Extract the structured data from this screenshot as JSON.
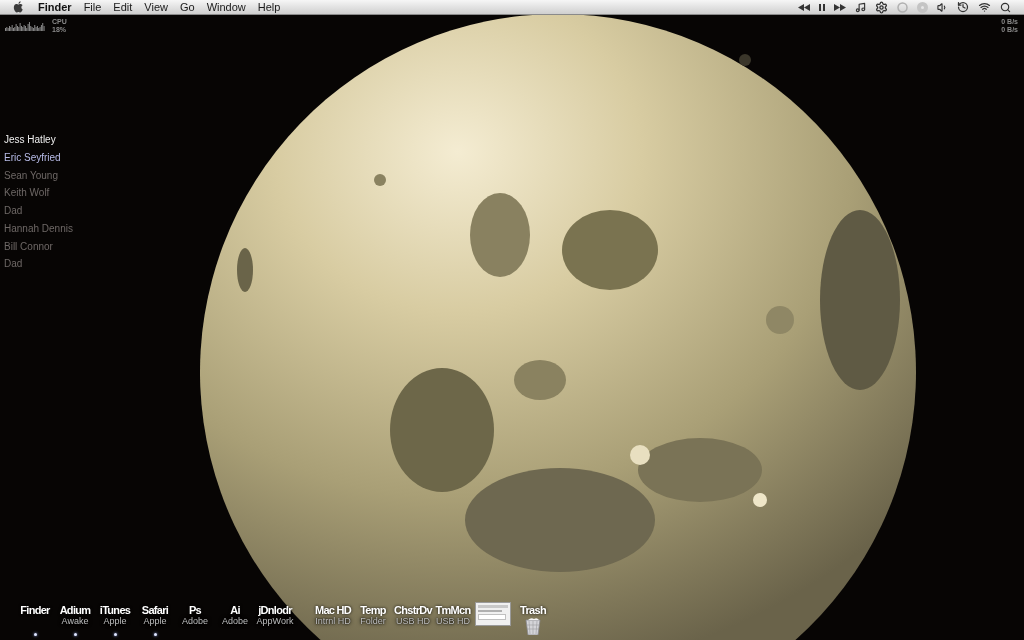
{
  "menu_bar": {
    "app_name": "Finder",
    "menus": [
      "File",
      "Edit",
      "View",
      "Go",
      "Window",
      "Help"
    ]
  },
  "cpu_monitor": {
    "label": "CPU",
    "reading": "18%"
  },
  "network_monitor": {
    "readings": [
      "0 B/s",
      "0 B/s"
    ]
  },
  "contacts": [
    {
      "name": "Jess Hatley",
      "color": "#f0f0f0"
    },
    {
      "name": "Eric Seyfried",
      "color": "#b8bce8"
    },
    {
      "name": "Sean Young",
      "color": "#6e6866"
    },
    {
      "name": "Keith Wolf",
      "color": "#6e6866"
    },
    {
      "name": "Dad",
      "color": "#6e6866"
    },
    {
      "name": "Hannah Dennis",
      "color": "#6e6866"
    },
    {
      "name": "Bill Connor",
      "color": "#6e6866"
    },
    {
      "name": "Dad",
      "color": "#6e6866"
    }
  ],
  "dock": {
    "apps": [
      {
        "label": "Finder",
        "running": true
      },
      {
        "label": "Adium",
        "sublabel": "Awake",
        "running": true
      },
      {
        "label": "iTunes",
        "sublabel": "Apple",
        "running": true
      },
      {
        "label": "Safari",
        "sublabel": "Apple",
        "running": true
      },
      {
        "label": "Ps",
        "sublabel": "Adobe",
        "running": false
      },
      {
        "label": "Ai",
        "sublabel": "Adobe",
        "running": false
      },
      {
        "label": "jDnlodr",
        "sublabel": "AppWork",
        "running": false
      }
    ],
    "documents": [
      {
        "kind": "text",
        "label": "Mac HD",
        "sublabel": "Intrnl HD"
      },
      {
        "kind": "text",
        "label": "Temp",
        "sublabel": "Folder"
      },
      {
        "kind": "text",
        "label": "ChstrDv",
        "sublabel": "USB HD"
      },
      {
        "kind": "text",
        "label": "TmMcn",
        "sublabel": "USB HD"
      },
      {
        "kind": "window"
      },
      {
        "kind": "trash",
        "label": "Trash"
      }
    ]
  }
}
